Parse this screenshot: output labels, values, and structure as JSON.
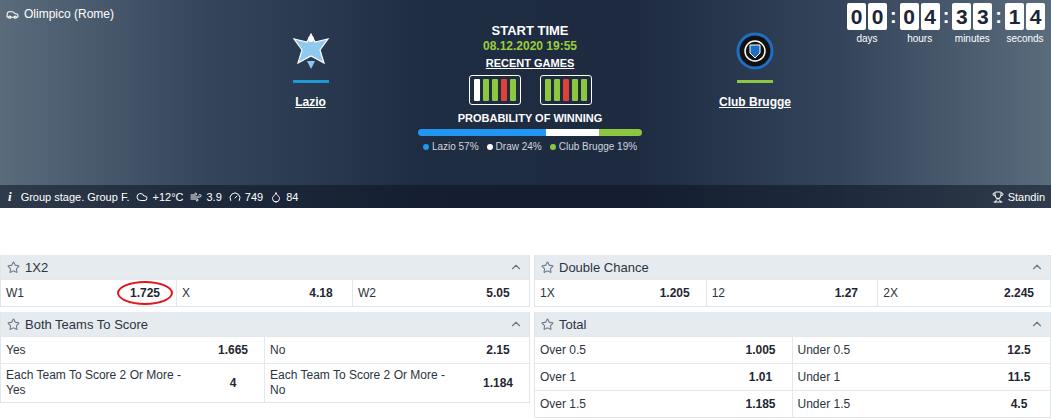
{
  "venue": "Olimpico (Rome)",
  "home": {
    "name": "Lazio",
    "color": "#1d9ad6"
  },
  "away": {
    "name": "Club Brugge",
    "color": "#8dc63f"
  },
  "start": {
    "label": "START TIME",
    "time": "08.12.2020 19:55"
  },
  "recent": {
    "label": "RECENT GAMES",
    "home": [
      "draw",
      "win",
      "win",
      "loss",
      "win"
    ],
    "away": [
      "win",
      "win",
      "loss",
      "win",
      "win"
    ]
  },
  "probability": {
    "label": "PROBABILITY OF WINNING",
    "items": [
      {
        "label": "Lazio 57%",
        "level": 0.57,
        "color": "#2196f3"
      },
      {
        "label": "Draw 24%",
        "level": 0.24,
        "color": "#ffffff"
      },
      {
        "label": "Club Brugge 19%",
        "level": 0.19,
        "color": "#8dc63f"
      }
    ]
  },
  "countdown": {
    "separator": ":",
    "units": [
      {
        "digits": [
          "0",
          "0"
        ],
        "unit": "days"
      },
      {
        "digits": [
          "0",
          "4"
        ],
        "unit": "hours"
      },
      {
        "digits": [
          "3",
          "3"
        ],
        "unit": "minutes"
      },
      {
        "digits": [
          "1",
          "4"
        ],
        "unit": "seconds"
      }
    ]
  },
  "info": {
    "icon": "i",
    "stage": "Group stage. Group F.",
    "temperature": "+12°C",
    "wind": "3.9",
    "pressure": "749",
    "humidity": "84",
    "standings": "Standin"
  },
  "markets": {
    "left": [
      {
        "title": "1X2",
        "expanded": true,
        "rows": [
          [
            {
              "label": "W1",
              "odds": "1.725",
              "highlighted": true
            },
            {
              "label": "X",
              "odds": "4.18",
              "highlighted": false
            },
            {
              "label": "W2",
              "odds": "5.05",
              "highlighted": false
            }
          ]
        ]
      },
      {
        "title": "Both Teams To Score",
        "expanded": true,
        "rows": [
          [
            {
              "label": "Yes",
              "odds": "1.665",
              "highlighted": false
            },
            {
              "label": "No",
              "odds": "2.15",
              "highlighted": false
            }
          ],
          [
            {
              "label": "Each Team To Score 2 Or More - Yes",
              "odds": "4",
              "highlighted": false
            },
            {
              "label": "Each Team To Score 2 Or More - No",
              "odds": "1.184",
              "highlighted": false
            }
          ]
        ]
      }
    ],
    "right": [
      {
        "title": "Double Chance",
        "expanded": true,
        "rows": [
          [
            {
              "label": "1X",
              "odds": "1.205",
              "highlighted": false
            },
            {
              "label": "12",
              "odds": "1.27",
              "highlighted": false
            },
            {
              "label": "2X",
              "odds": "2.245",
              "highlighted": false
            }
          ]
        ]
      },
      {
        "title": "Total",
        "expanded": true,
        "rows": [
          [
            {
              "label": "Over 0.5",
              "odds": "1.005",
              "highlighted": false
            },
            {
              "label": "Under 0.5",
              "odds": "12.5",
              "highlighted": false
            }
          ],
          [
            {
              "label": "Over 1",
              "odds": "1.01",
              "highlighted": false
            },
            {
              "label": "Under 1",
              "odds": "11.5",
              "highlighted": false
            }
          ],
          [
            {
              "label": "Over 1.5",
              "odds": "1.185",
              "highlighted": false
            },
            {
              "label": "Under 1.5",
              "odds": "4.5",
              "highlighted": false
            }
          ]
        ]
      }
    ]
  }
}
